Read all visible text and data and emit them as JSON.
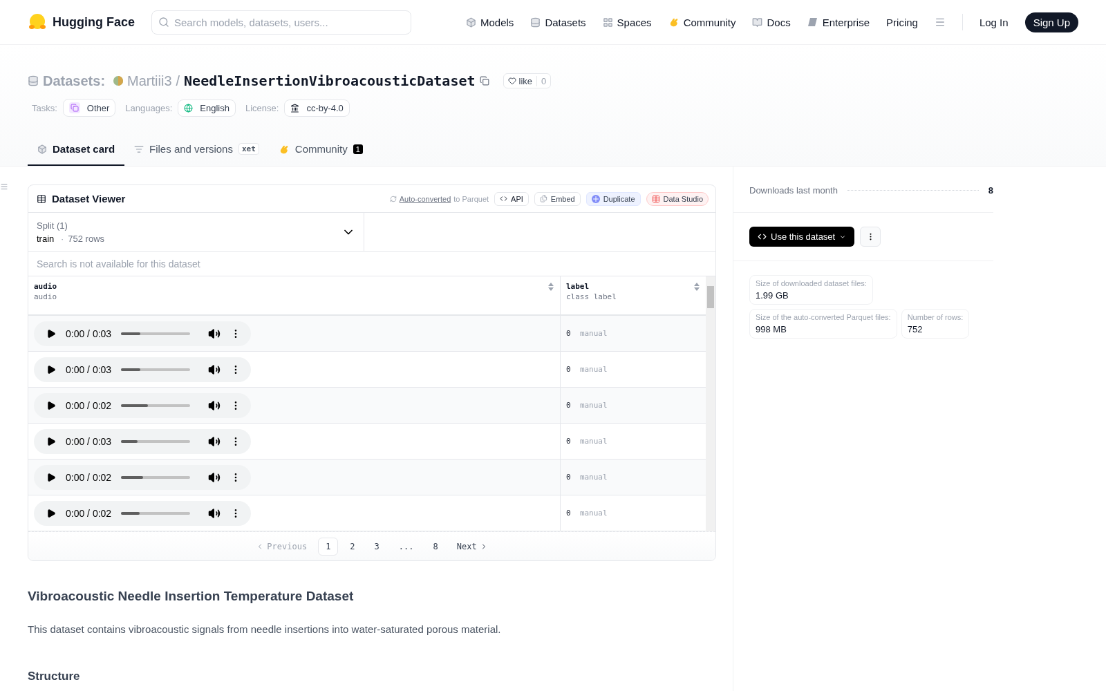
{
  "nav": {
    "logo": "Hugging Face",
    "search_placeholder": "Search models, datasets, users...",
    "items": [
      {
        "label": "Models"
      },
      {
        "label": "Datasets"
      },
      {
        "label": "Spaces"
      },
      {
        "label": "Community"
      },
      {
        "label": "Docs"
      },
      {
        "label": "Enterprise"
      },
      {
        "label": "Pricing"
      }
    ],
    "login": "Log In",
    "signup": "Sign Up"
  },
  "repo": {
    "section": "Datasets:",
    "owner": "Martiii3",
    "separator": "/",
    "name": "NeedleInsertionVibroacousticDataset",
    "like": "like",
    "likes": "0"
  },
  "tags": [
    {
      "label": "Tasks:",
      "value": "Other"
    },
    {
      "label": "Languages:",
      "value": "English"
    },
    {
      "label": "License:",
      "value": "cc-by-4.0"
    }
  ],
  "tabs": [
    {
      "label": "Dataset card",
      "selected": true
    },
    {
      "label": "Files and versions",
      "selected": false,
      "tag": "xet"
    },
    {
      "label": "Community",
      "selected": false,
      "count": "1"
    }
  ],
  "viewer": {
    "title": "Dataset Viewer",
    "converted_link": "Auto-converted",
    "converted_rest": "to Parquet",
    "actions": [
      {
        "label": "API",
        "kind": "api"
      },
      {
        "label": "Embed",
        "kind": "embed"
      },
      {
        "label": "Duplicate",
        "kind": "duplicate"
      },
      {
        "label": "Data Studio",
        "kind": "studio"
      }
    ],
    "split": {
      "label": "Split (1)",
      "value": "train",
      "dot": "·",
      "rows": "752 rows"
    },
    "search_placeholder": "Search is not available for this dataset",
    "columns": [
      {
        "name": "audio",
        "type": "audio"
      },
      {
        "name": "label",
        "type": "class label"
      }
    ],
    "rows": [
      {
        "time": "0:00 / 0:03",
        "level": 0.28,
        "label_value": "0",
        "label_name": "manual"
      },
      {
        "time": "0:00 / 0:03",
        "level": 0.28,
        "label_value": "0",
        "label_name": "manual"
      },
      {
        "time": "0:00 / 0:02",
        "level": 0.39,
        "label_value": "0",
        "label_name": "manual"
      },
      {
        "time": "0:00 / 0:03",
        "level": 0.24,
        "label_value": "0",
        "label_name": "manual"
      },
      {
        "time": "0:00 / 0:02",
        "level": 0.32,
        "label_value": "0",
        "label_name": "manual"
      },
      {
        "time": "0:00 / 0:02",
        "level": 0.27,
        "label_value": "0",
        "label_name": "manual"
      }
    ],
    "pagination": {
      "previous": "Previous",
      "next": "Next",
      "pages": [
        {
          "label": "1",
          "selected": true
        },
        {
          "label": "2",
          "selected": false
        },
        {
          "label": "3",
          "selected": false
        },
        {
          "label": "...",
          "selected": false
        },
        {
          "label": "8",
          "selected": false
        }
      ]
    }
  },
  "card": {
    "heading": "Vibroacoustic Needle Insertion Temperature Dataset",
    "paragraph": "This dataset contains vibroacoustic signals from needle insertions into water-saturated porous material.",
    "subheading": "Structure"
  },
  "sidebar": {
    "downloads_label": "Downloads last month",
    "downloads_value": "8",
    "use_button": "Use this dataset",
    "stats": [
      {
        "label": "Size of downloaded dataset files:",
        "value": "1.99 GB"
      },
      {
        "label": "Size of the auto-converted Parquet files:",
        "value": "998 MB"
      },
      {
        "label": "Number of rows:",
        "value": "752"
      }
    ]
  }
}
